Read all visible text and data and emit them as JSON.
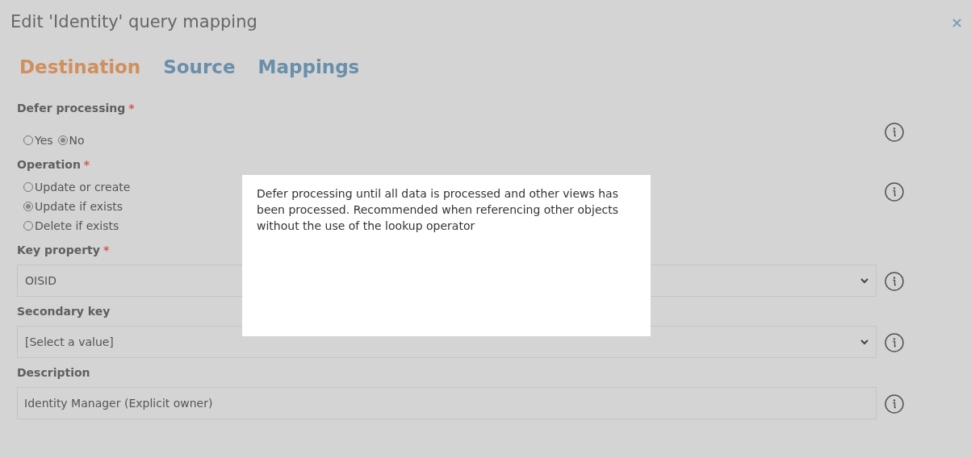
{
  "dialog": {
    "title": "Edit 'Identity' query mapping",
    "close": "×"
  },
  "tabs": [
    {
      "label": "Destination",
      "selected": true
    },
    {
      "label": "Source",
      "selected": false
    },
    {
      "label": "Mappings",
      "selected": false
    }
  ],
  "fields": [
    {
      "kind": "radio_row",
      "label": "Defer processing",
      "required_mark": "*",
      "options": [
        {
          "label": "Yes",
          "selected": false
        },
        {
          "label": "No",
          "selected": true
        }
      ]
    },
    {
      "kind": "radio_list",
      "label": "Operation",
      "required_mark": "*",
      "options": [
        {
          "label": "Update or create",
          "selected": false
        },
        {
          "label": "Update if exists",
          "selected": true
        },
        {
          "label": "Delete if exists",
          "selected": false
        }
      ]
    },
    {
      "kind": "select",
      "label": "Key property",
      "required_mark": "*",
      "value": "OISID"
    },
    {
      "kind": "select",
      "label": "Secondary key",
      "value": "[Select a value]"
    },
    {
      "kind": "text",
      "label": "Description",
      "value": "Identity Manager (Explicit owner)"
    }
  ],
  "tooltip": {
    "text": "Defer processing until all data is processed and other views has been processed. Recommended when referencing other objects without the use of the lookup operator"
  }
}
